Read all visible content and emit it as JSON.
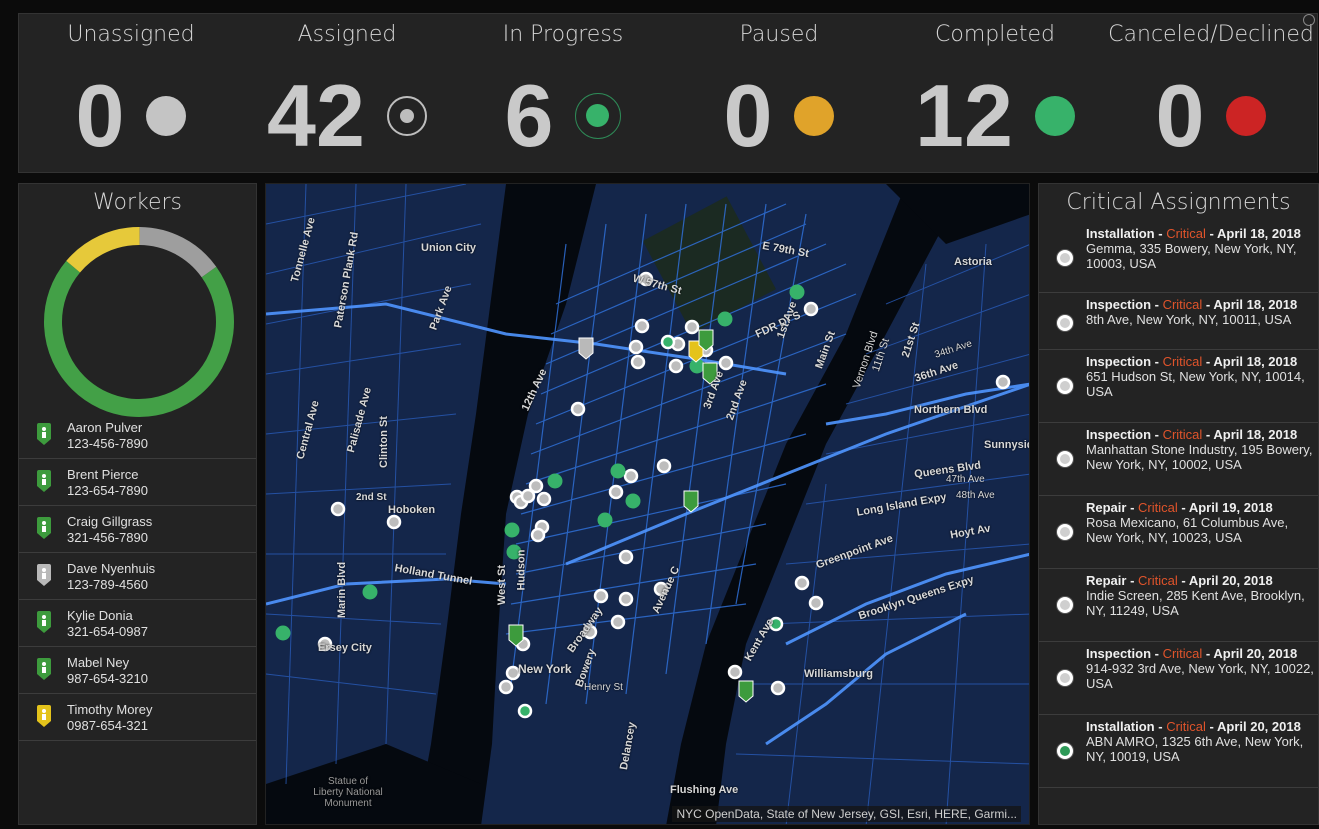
{
  "stats": [
    {
      "label": "Unassigned",
      "value": "0",
      "color": "#c4c4c4",
      "style": "solid"
    },
    {
      "label": "Assigned",
      "value": "42",
      "color": "#bdbdbd",
      "style": "ring"
    },
    {
      "label": "In Progress",
      "value": "6",
      "color": "#37b26a",
      "style": "ring-green"
    },
    {
      "label": "Paused",
      "value": "0",
      "color": "#e0a32a",
      "style": "solid"
    },
    {
      "label": "Completed",
      "value": "12",
      "color": "#37b26a",
      "style": "solid"
    },
    {
      "label": "Canceled/Declined",
      "value": "0",
      "color": "#cc2424",
      "style": "solid"
    }
  ],
  "workers": {
    "title": "Workers",
    "donut": [
      {
        "status": "working",
        "fraction": 0.71,
        "color": "#43a047"
      },
      {
        "status": "paused",
        "fraction": 0.14,
        "color": "#e6c93a"
      },
      {
        "status": "off",
        "fraction": 0.15,
        "color": "#9e9e9e"
      }
    ],
    "list": [
      {
        "name": "Aaron Pulver",
        "phone": "123-456-7890",
        "pin_color": "#3d9b3d"
      },
      {
        "name": "Brent Pierce",
        "phone": "123-654-7890",
        "pin_color": "#3d9b3d"
      },
      {
        "name": "Craig Gillgrass",
        "phone": "321-456-7890",
        "pin_color": "#3d9b3d"
      },
      {
        "name": "Dave Nyenhuis",
        "phone": "123-789-4560",
        "pin_color": "#b9b9b9"
      },
      {
        "name": "Kylie Donia",
        "phone": "321-654-0987",
        "pin_color": "#3d9b3d"
      },
      {
        "name": "Mabel Ney",
        "phone": "987-654-3210",
        "pin_color": "#3d9b3d"
      },
      {
        "name": "Timothy Morey",
        "phone": "0987-654-321",
        "pin_color": "#e4c31b"
      }
    ]
  },
  "map": {
    "attribution": "NYC OpenData, State of New Jersey, GSI, Esri, HERE, Garmi...",
    "labels": [
      "Union City",
      "Hoboken",
      "Holland Tunnel",
      "New York",
      "Williamsburg",
      "Astoria",
      "Flushing Ave",
      "Northern Blvd",
      "Queens Blvd",
      "Long Island Expy",
      "Greenpoint Ave",
      "Brooklyn Queens Expy",
      "Broadway",
      "Park Ave",
      "12th Ave",
      "W 57th St",
      "FDR Dr S",
      "Ersey City",
      "Statue of Liberty National Monument",
      "Sunnyside",
      "Paterson Plank Rd",
      "Tonnelle Ave",
      "Central Ave",
      "Palisade Ave",
      "Clinton St",
      "2nd St",
      "Marin Blvd",
      "West St",
      "Hudson",
      "Bowery",
      "Avenue C",
      "Kent Ave",
      "Henry St",
      "Delancey",
      "E 79th St",
      "1st Ave",
      "3rd Ave",
      "2nd Ave",
      "Main St",
      "Vernon Blvd",
      "21st St",
      "11th St",
      "36th Ave",
      "34th Ave",
      "47th Ave",
      "48th Ave",
      "Hoyt Av"
    ]
  },
  "critical": {
    "title": "Critical Assignments",
    "items": [
      {
        "type": "Installation",
        "severity": "Critical",
        "date": "April 18, 2018",
        "address": "Gemma, 335 Bowery, New York, NY, 10003, USA",
        "status": "assigned"
      },
      {
        "type": "Inspection",
        "severity": "Critical",
        "date": "April 18, 2018",
        "address": "8th Ave, New York, NY, 10011, USA",
        "status": "assigned"
      },
      {
        "type": "Inspection",
        "severity": "Critical",
        "date": "April 18, 2018",
        "address": "651 Hudson St, New York, NY, 10014, USA",
        "status": "assigned"
      },
      {
        "type": "Inspection",
        "severity": "Critical",
        "date": "April 18, 2018",
        "address": "Manhattan Stone Industry, 195 Bowery, New York, NY, 10002, USA",
        "status": "assigned"
      },
      {
        "type": "Repair",
        "severity": "Critical",
        "date": "April 19, 2018",
        "address": "Rosa Mexicano, 61 Columbus Ave, New York, NY, 10023, USA",
        "status": "assigned"
      },
      {
        "type": "Repair",
        "severity": "Critical",
        "date": "April 20, 2018",
        "address": "Indie Screen, 285 Kent Ave, Brooklyn, NY, 11249, USA",
        "status": "assigned"
      },
      {
        "type": "Inspection",
        "severity": "Critical",
        "date": "April 20, 2018",
        "address": "914-932 3rd Ave, New York, NY, 10022, USA",
        "status": "assigned"
      },
      {
        "type": "Installation",
        "severity": "Critical",
        "date": "April 20, 2018",
        "address": "ABN AMRO, 1325 6th Ave, New York, NY, 10019, USA",
        "status": "in-progress"
      }
    ]
  }
}
